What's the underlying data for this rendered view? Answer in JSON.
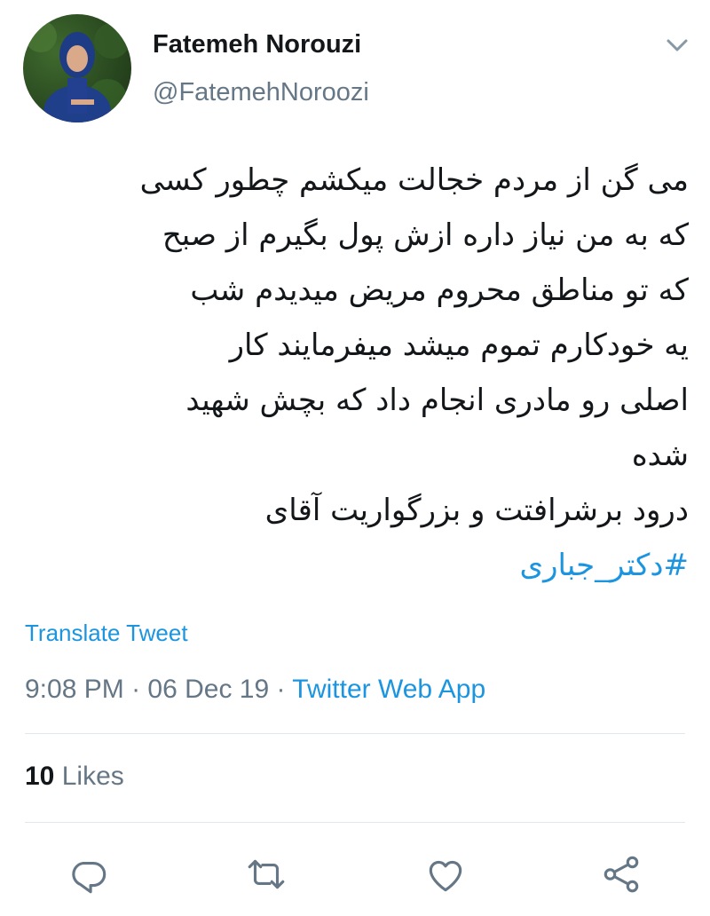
{
  "author": {
    "name": "Fatemeh Norouzi",
    "handle": "@FatemehNoroozi"
  },
  "tweet": {
    "lines": [
      "می گن از مردم خجالت میکشم چطور کسی",
      "که به من نیاز داره ازش پول بگیرم از صبح",
      "که تو مناطق محروم مریض میدیدم شب",
      "یه خودکارم تموم میشد میفرمایند کار",
      "اصلی رو مادری انجام داد که بچش شهید",
      "شده",
      "درود برشرافتت و بزرگواریت آقای"
    ],
    "hashtag": "#دکتر_جباری"
  },
  "translate_label": "Translate Tweet",
  "meta": {
    "time": "9:08 PM",
    "separator": " · ",
    "date": "06 Dec 19",
    "source": "Twitter Web App"
  },
  "likes": {
    "count": "10",
    "label": "Likes"
  },
  "icons": {
    "reply": "reply-icon",
    "retweet": "retweet-icon",
    "like": "heart-icon",
    "share": "share-icon",
    "caret": "chevron-down-icon"
  },
  "colors": {
    "link": "#1b95e0",
    "secondary": "#657786",
    "text": "#14171a",
    "divider": "#e1e8ed"
  }
}
